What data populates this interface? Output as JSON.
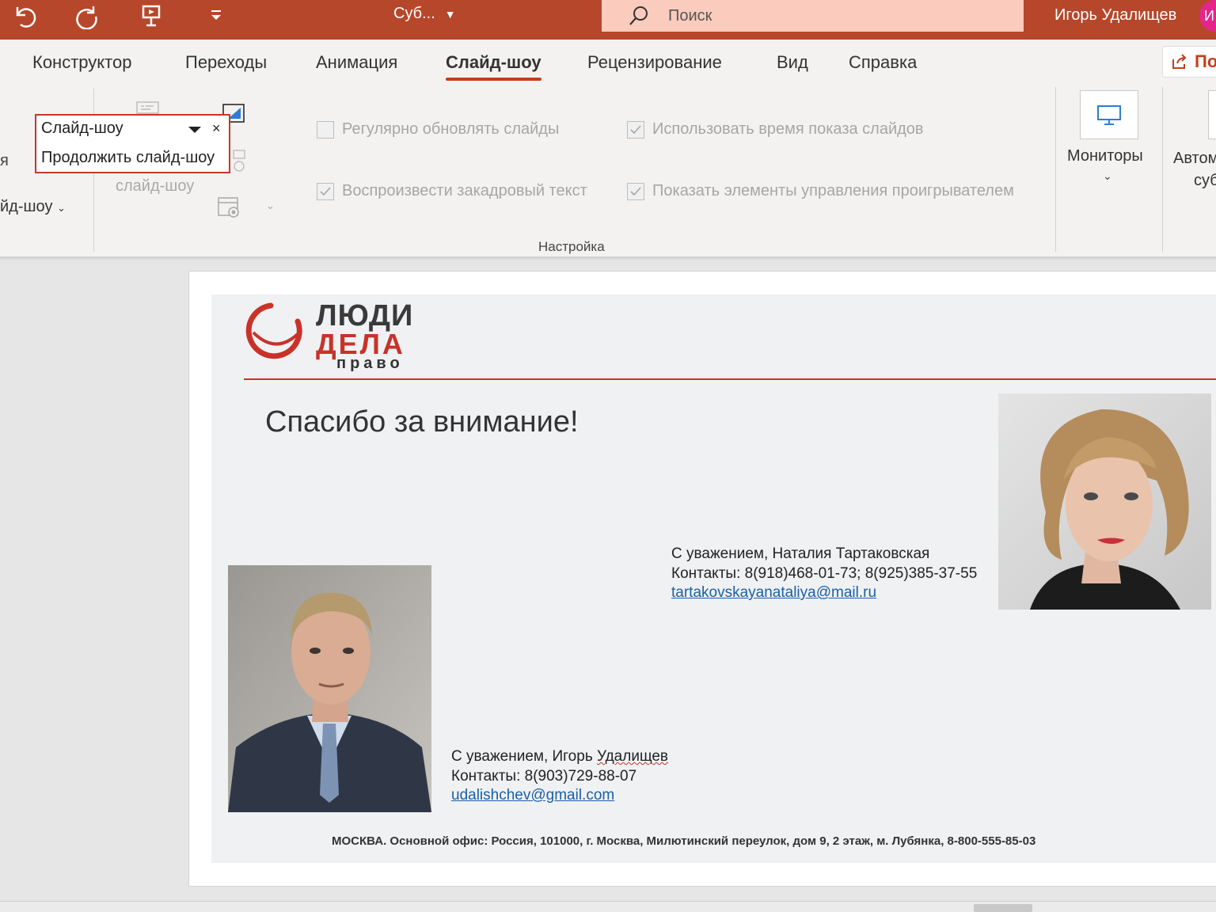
{
  "titlebar": {
    "doc_title": "Суб...",
    "search_placeholder": "Поиск",
    "user_name": "Игорь Удалищев",
    "avatar_initial": "И",
    "color": "#b7472a"
  },
  "tabs": [
    {
      "label": "Конструктор"
    },
    {
      "label": "Переходы"
    },
    {
      "label": "Анимация"
    },
    {
      "label": "Слайд-шоу",
      "active": true
    },
    {
      "label": "Рецензирование"
    },
    {
      "label": "Вид"
    },
    {
      "label": "Справка"
    }
  ],
  "share_label": "По",
  "ribbon": {
    "left_cut_1": "я",
    "left_cut_2": "йд-шоу",
    "faded_label": "слайд-шоу",
    "checkboxes": [
      {
        "label": "Регулярно обновлять слайды",
        "checked": false
      },
      {
        "label": "Использовать время показа слайдов",
        "checked": true
      },
      {
        "label": "Воспроизвести закадровый текст",
        "checked": true
      },
      {
        "label": "Показать элементы управления проигрывателем",
        "checked": true
      }
    ],
    "group_label": "Настройка",
    "monitors_label": "Мониторы",
    "auto_label_1": "Автом",
    "auto_label_2": "суб"
  },
  "popup": {
    "title": "Слайд-шоу",
    "item": "Продолжить слайд-шоу",
    "close": "×"
  },
  "slide": {
    "logo": {
      "line1": "ЛЮДИ",
      "line2": "ДЕЛА",
      "line3": "право"
    },
    "headline": "Спасибо за внимание!",
    "contact1": {
      "regards_prefix": "С уважением, Наталия Тартаковская",
      "phones": "Контакты: 8(918)468-01-73; 8(925)385-37-55",
      "email": "tartakovskayanataliya@mail.ru"
    },
    "contact2": {
      "regards_prefix": "С уважением, Игорь ",
      "regards_name": "Удалищев",
      "phones": "Контакты: 8(903)729-88-07",
      "email": "udalishchev@gmail.com"
    },
    "footer": "МОСКВА. Основной офис: Россия, 101000, г. Москва, Милютинский переулок, дом 9, 2 этаж, м. Лубянка, 8-800-555-85-03"
  }
}
